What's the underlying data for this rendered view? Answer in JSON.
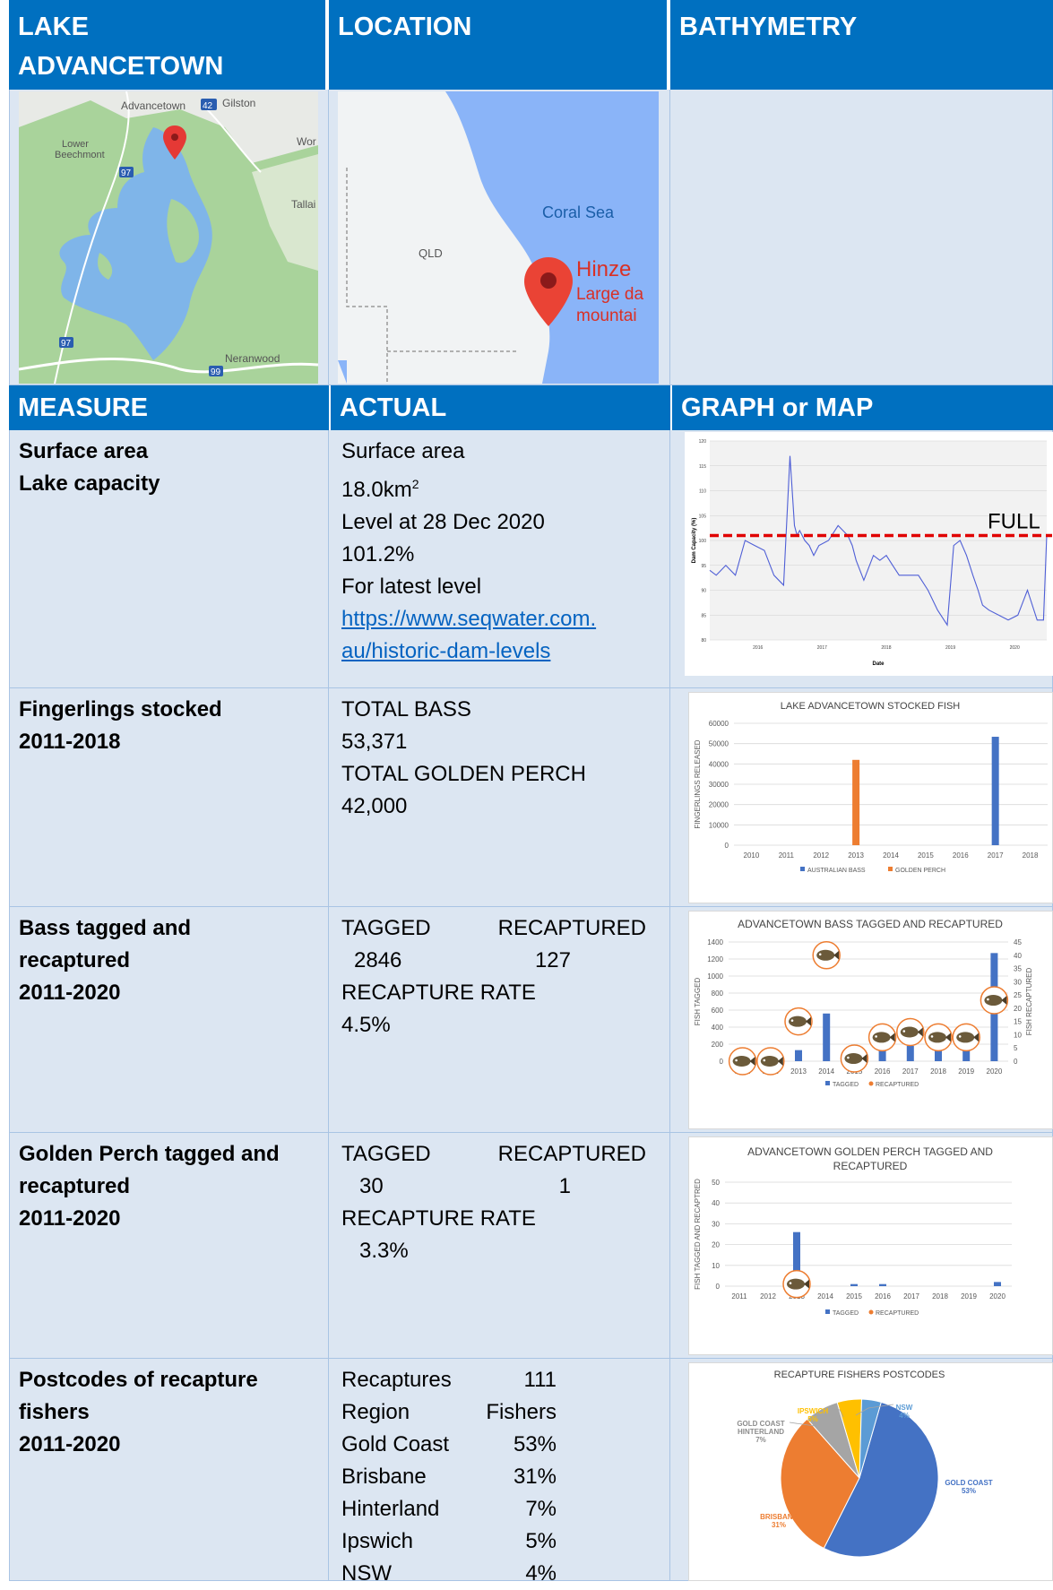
{
  "header": {
    "col1": "LAKE ADVANCETOWN",
    "col2": "LOCATION",
    "col3": "BATHYMETRY"
  },
  "maps": {
    "local": {
      "labels": [
        "Advancetown",
        "Gilston",
        "Lower Beechmont",
        "Wor",
        "Tallai",
        "Neranwood"
      ],
      "road_numbers": [
        "42",
        "97",
        "97",
        "99"
      ]
    },
    "region": {
      "sea_label": "Coral Sea",
      "state_label": "QLD",
      "pin_title": "Hinze",
      "pin_sub1": "Large da",
      "pin_sub2": "mountai"
    }
  },
  "subheader": {
    "col1": "MEASURE",
    "col2": "ACTUAL",
    "col3": "GRAPH or MAP"
  },
  "rows": {
    "surface": {
      "measure1": "Surface area",
      "measure2": "Lake capacity",
      "actual_lines": [
        "Surface area",
        "18.0km",
        "Level at 28 Dec 2020",
        "101.2%",
        "For latest level"
      ],
      "superscript": "2",
      "link1": "https://www.seqwater.com.",
      "link2": "au/historic-dam-levels"
    },
    "fingerlings": {
      "measure1": "Fingerlings stocked",
      "measure2": "2011-2018",
      "actual_lines": [
        "TOTAL BASS",
        "53,371",
        "TOTAL GOLDEN PERCH",
        "42,000"
      ]
    },
    "bass": {
      "measure1": "Bass tagged and",
      "measure2": "recaptured",
      "measure3": "2011-2020",
      "tagged_label": "TAGGED",
      "recaptured_label": "RECAPTURED",
      "tagged_value": "2846",
      "recaptured_value": "127",
      "rate_label": "RECAPTURE RATE",
      "rate_value": "4.5%"
    },
    "perch": {
      "measure1": "Golden Perch tagged and",
      "measure2": "recaptured",
      "measure3": "2011-2020",
      "tagged_label": "TAGGED",
      "recaptured_label": "RECAPTURED",
      "tagged_value": "30",
      "recaptured_value": "1",
      "rate_label": "RECAPTURE RATE",
      "rate_value": "3.3%"
    },
    "postcodes": {
      "measure1": "Postcodes of recapture",
      "measure2": "fishers",
      "measure3": "2011-2020",
      "table": [
        [
          "Recaptures",
          "111"
        ],
        [
          "Region",
          "Fishers"
        ],
        [
          "Gold Coast",
          "53%"
        ],
        [
          "Brisbane",
          "31%"
        ],
        [
          "Hinterland",
          "7%"
        ],
        [
          "Ipswich",
          "5%"
        ],
        [
          "NSW",
          "4%"
        ]
      ]
    }
  },
  "colors": {
    "header_blue": "#0070c0",
    "cell_bg": "#dce6f2",
    "bar_blue": "#4472c4",
    "bar_orange": "#ed7d31",
    "full_line_red": "#e00000"
  },
  "chart_data": [
    {
      "type": "line",
      "title": "",
      "xlabel": "Date",
      "ylabel": "Dam Capacity (%)",
      "x_ticks": [
        "2016",
        "2017",
        "2018",
        "2019",
        "2020"
      ],
      "y_ticks": [
        "80",
        "85",
        "90",
        "95",
        "100",
        "105",
        "110",
        "115",
        "120"
      ],
      "ylim": [
        80,
        120
      ],
      "annotation": "FULL",
      "full_level": 101,
      "series": [
        {
          "x": [
            2015.3,
            2015.4,
            2015.55,
            2015.7,
            2015.85,
            2016.0,
            2016.15,
            2016.3,
            2016.45,
            2016.55,
            2016.62,
            2016.66,
            2016.7,
            2016.78,
            2016.85,
            2016.92,
            2017.0,
            2017.15,
            2017.3,
            2017.45,
            2017.52,
            2017.58,
            2017.7,
            2017.85,
            2017.95,
            2018.05,
            2018.15,
            2018.25,
            2018.4,
            2018.55,
            2018.7,
            2018.85,
            2019.0,
            2019.1,
            2019.2,
            2019.3,
            2019.4,
            2019.48,
            2019.55,
            2019.65,
            2019.8,
            2019.95,
            2020.1,
            2020.25,
            2020.4,
            2020.5,
            2020.55
          ],
          "y": [
            94,
            93,
            95,
            93,
            100,
            99,
            98,
            93,
            91,
            117,
            103,
            101,
            102,
            100,
            99,
            97,
            99,
            100,
            103,
            101,
            99,
            96,
            92,
            97,
            96,
            97,
            95,
            93,
            93,
            93,
            90,
            86,
            83,
            99,
            100,
            97,
            93,
            90,
            87,
            86,
            85,
            84,
            85,
            90,
            84,
            84,
            101
          ]
        }
      ]
    },
    {
      "type": "bar",
      "title": "LAKE ADVANCETOWN STOCKED FISH",
      "xlabel": "",
      "ylabel": "FINGERLINGS RELEASED",
      "categories": [
        "2010",
        "2011",
        "2012",
        "2013",
        "2014",
        "2015",
        "2016",
        "2017",
        "2018"
      ],
      "ylim": [
        0,
        60000
      ],
      "y_ticks": [
        "0",
        "10000",
        "20000",
        "30000",
        "40000",
        "50000",
        "60000"
      ],
      "series": [
        {
          "name": "AUSTRALIAN BASS",
          "values": [
            0,
            0,
            0,
            0,
            0,
            0,
            0,
            53371,
            0
          ]
        },
        {
          "name": "GOLDEN PERCH",
          "values": [
            0,
            0,
            0,
            42000,
            0,
            0,
            0,
            0,
            0
          ]
        }
      ],
      "legend": "bottom"
    },
    {
      "type": "bar",
      "title": "ADVANCETOWN BASS TAGGED AND RECAPTURED",
      "ylabel": "FISH TAGGED",
      "y2label": "FISH RECAPTURED",
      "categories": [
        "2011",
        "2012",
        "2013",
        "2014",
        "2015",
        "2016",
        "2017",
        "2018",
        "2019",
        "2020"
      ],
      "ylim": [
        0,
        1400
      ],
      "y2lim": [
        0,
        45
      ],
      "y_ticks": [
        "0",
        "200",
        "400",
        "600",
        "800",
        "1000",
        "1200",
        "1400"
      ],
      "y2_ticks": [
        "0",
        "5",
        "10",
        "15",
        "20",
        "25",
        "30",
        "35",
        "40",
        "45"
      ],
      "series": [
        {
          "name": "TAGGED",
          "values": [
            10,
            30,
            130,
            560,
            140,
            155,
            180,
            170,
            150,
            1270
          ]
        },
        {
          "name": "RECAPTURED",
          "values": [
            0,
            0,
            15,
            40,
            1,
            9,
            11,
            9,
            9,
            23
          ]
        }
      ],
      "legend": "bottom"
    },
    {
      "type": "bar",
      "title": "ADVANCETOWN GOLDEN PERCH TAGGED AND RECAPTURED",
      "title_line1": "ADVANCETOWN GOLDEN PERCH TAGGED AND",
      "title_line2": "RECAPTURED",
      "ylabel": "FISH TAGGED AND RECAPTRED",
      "categories": [
        "2011",
        "2012",
        "2013",
        "2014",
        "2015",
        "2016",
        "2017",
        "2018",
        "2019",
        "2020"
      ],
      "ylim": [
        0,
        50
      ],
      "y_ticks": [
        "0",
        "10",
        "20",
        "30",
        "40",
        "50"
      ],
      "series": [
        {
          "name": "TAGGED",
          "values": [
            0,
            0,
            26,
            0,
            1,
            1,
            0,
            0,
            0,
            2
          ]
        },
        {
          "name": "RECAPTURED",
          "values": [
            0,
            0,
            1,
            0,
            0,
            0,
            0,
            0,
            0,
            0
          ]
        }
      ],
      "legend": "bottom"
    },
    {
      "type": "pie",
      "title": "RECAPTURE FISHERS POSTCODES",
      "slices": [
        {
          "name": "GOLD COAST",
          "value": 53,
          "label": "53%",
          "color": "#4472c4"
        },
        {
          "name": "BRISBANE",
          "value": 31,
          "label": "31%",
          "color": "#ed7d31"
        },
        {
          "name": "GOLD COAST HINTERLAND",
          "value": 7,
          "label": "7%",
          "color": "#a5a5a5"
        },
        {
          "name": "IPSWICH",
          "value": 5,
          "label": "5%",
          "color": "#ffc000"
        },
        {
          "name": "NSW",
          "value": 4,
          "label": "4%",
          "color": "#5b9bd5"
        }
      ]
    }
  ]
}
